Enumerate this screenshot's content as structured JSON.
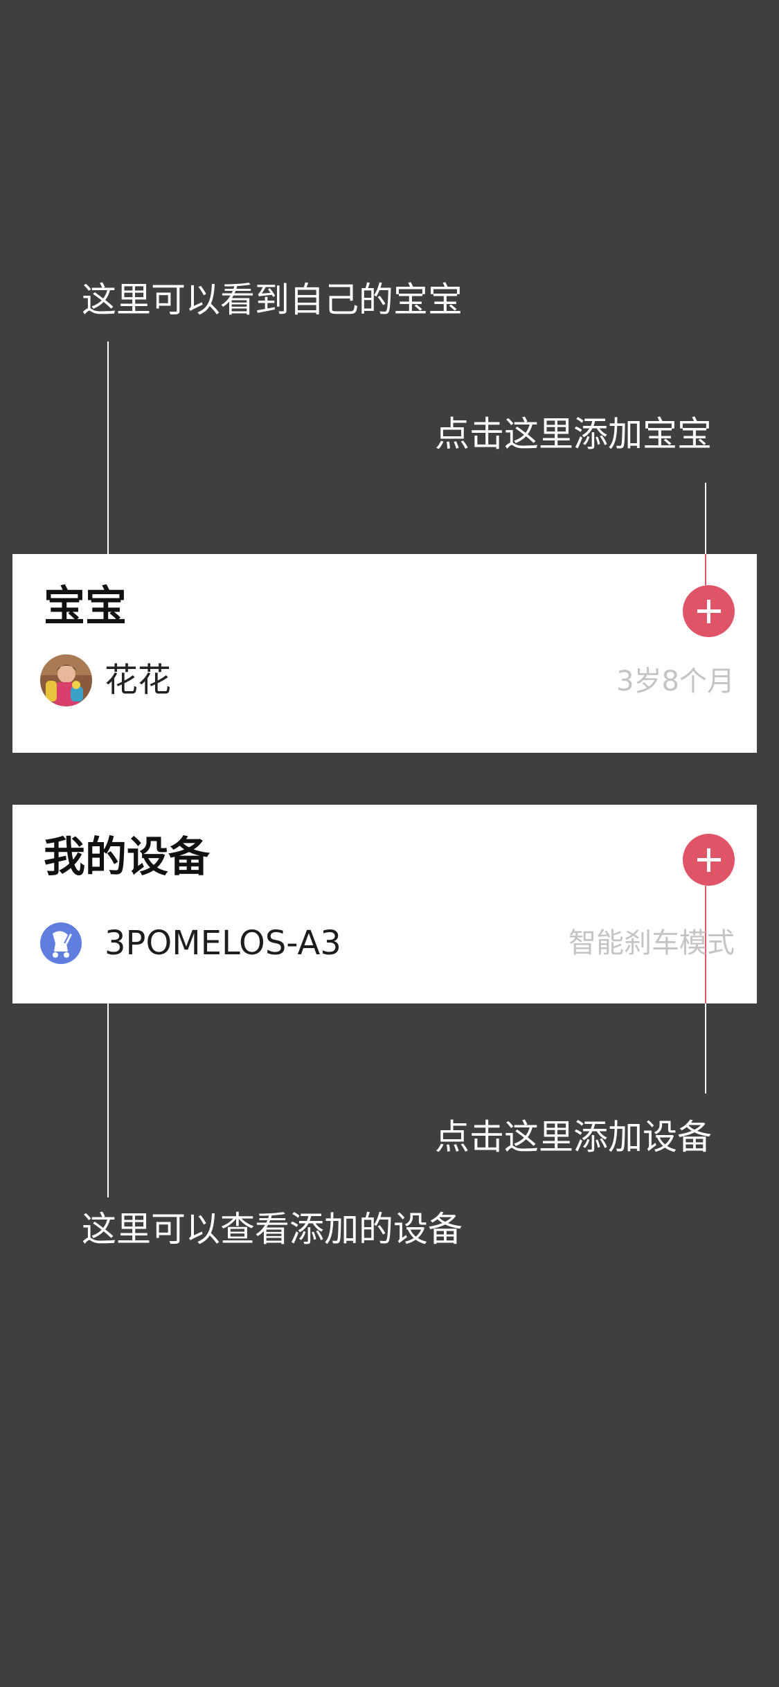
{
  "annotations": {
    "view_babies": "这里可以看到自己的宝宝",
    "add_baby": "点击这里添加宝宝",
    "add_device": "点击这里添加设备",
    "view_devices": "这里可以查看添加的设备"
  },
  "baby_card": {
    "title": "宝宝",
    "items": [
      {
        "name": "花花",
        "age": "3岁8个月",
        "avatar": "baby-photo"
      }
    ]
  },
  "device_card": {
    "title": "我的设备",
    "items": [
      {
        "name": "3POMELOS-A3",
        "mode": "智能刹车模式",
        "icon": "stroller-icon"
      }
    ]
  },
  "colors": {
    "background": "#3f3f3f",
    "accent": "#e05467",
    "device_icon": "#5f7ede",
    "meta_text": "#c4c4c4"
  }
}
